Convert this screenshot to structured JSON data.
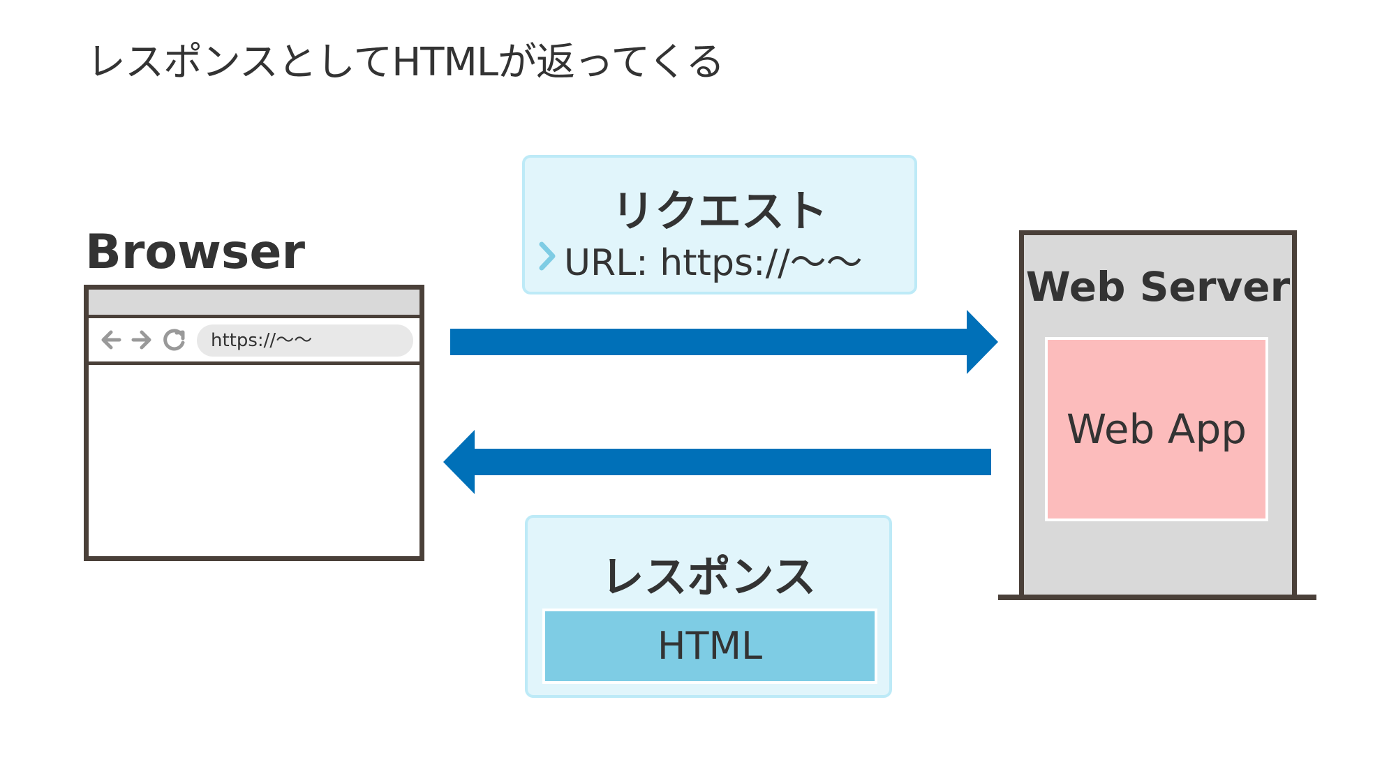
{
  "title": "レスポンスとしてHTMLが返ってくる",
  "browser": {
    "label": "Browser",
    "address": "https://〜〜",
    "nav_icons": [
      "back-arrow-icon",
      "forward-arrow-icon",
      "reload-icon"
    ]
  },
  "request": {
    "title": "リクエスト",
    "url_line": "URL: https://〜〜",
    "url_icon": "chevron-right-icon"
  },
  "response": {
    "title": "レスポンス",
    "payload": "HTML"
  },
  "server": {
    "label": "Web Server",
    "app_label": "Web App"
  },
  "colors": {
    "arrow": "#0070b8",
    "callout_bg": "#e1f5fb",
    "callout_border": "#bdeaf7",
    "html_block": "#7ecce4",
    "web_app": "#fcbcbc",
    "server_bg": "#d9d9d9",
    "outline": "#4a4039",
    "chevron": "#7ecce4"
  }
}
